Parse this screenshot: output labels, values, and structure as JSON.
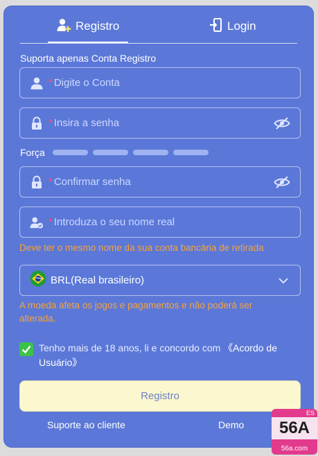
{
  "tabs": [
    {
      "label": "Registro",
      "icon": "add-user-icon",
      "active": true
    },
    {
      "label": "Login",
      "icon": "login-door-icon",
      "active": false
    }
  ],
  "form_title": "Suporta apenas Conta Registro",
  "fields": {
    "account": {
      "required_mark": "*",
      "placeholder": "Digite o Conta",
      "icon": "user-icon"
    },
    "password": {
      "required_mark": "*",
      "placeholder": "Insira a senha",
      "icon": "lock-icon"
    },
    "confirm": {
      "required_mark": "*",
      "placeholder": "Confirmar senha",
      "icon": "lock-icon"
    },
    "real_name": {
      "required_mark": "*",
      "placeholder": "Introduza o seu nome real",
      "icon": "user-verified-icon"
    }
  },
  "strength": {
    "label": "Força",
    "segments": 4,
    "level": 0
  },
  "real_name_hint": "Deve ter o mesmo nome da sua conta bancária de retirada",
  "currency": {
    "value": "BRL(Real brasileiro)",
    "flag": "brazil-flag-icon"
  },
  "currency_hint_line1": "A moeda afeta os jogos e pagamentos e não poderá ser",
  "currency_hint_line2": "alterada.",
  "agreement": {
    "checked": true,
    "text": "Tenho mais de 18 anos, li e concordo com ",
    "link_line1": "《Acordo de",
    "link_line2": "Usuário》"
  },
  "submit_label": "Registro",
  "footer": {
    "support": "Suporte ao cliente",
    "demo": "Demo"
  },
  "watermark": {
    "corner": "ES",
    "main": "56A",
    "domain": "56a.com"
  },
  "colors": {
    "panel": "#5b78d8",
    "accent_button": "#fbf8cf",
    "hint": "#f7a23a",
    "checkbox": "#3cc24a",
    "required": "#ff4d6a"
  }
}
